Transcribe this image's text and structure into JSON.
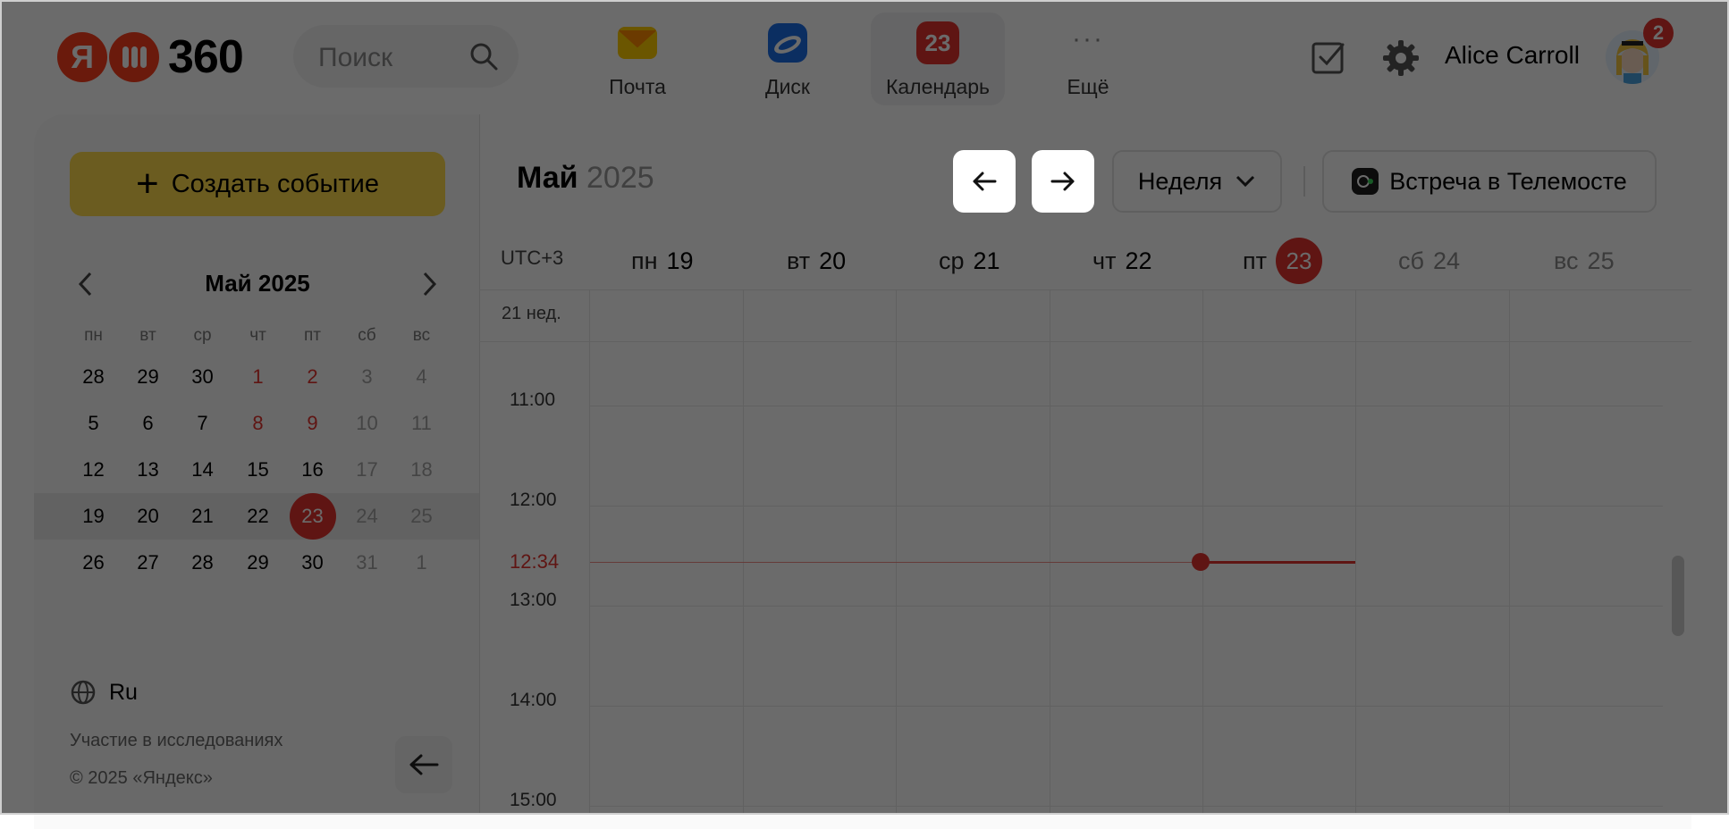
{
  "header": {
    "logo_text": "360",
    "logo_letter": "Я",
    "search_placeholder": "Поиск",
    "apps": [
      {
        "label": "Почта"
      },
      {
        "label": "Диск"
      },
      {
        "label": "Календарь",
        "icon_text": "23"
      },
      {
        "label": "Ещё",
        "icon_text": "···"
      }
    ],
    "user_name": "Alice Carroll",
    "notification_count": "2"
  },
  "sidebar": {
    "create_label": "Создать событие",
    "mini_calendar": {
      "title": "Май 2025",
      "weekdays": [
        "пн",
        "вт",
        "ср",
        "чт",
        "пт",
        "сб",
        "вс"
      ],
      "weeks": [
        [
          "28",
          "29",
          "30",
          "1",
          "2",
          "3",
          "4"
        ],
        [
          "5",
          "6",
          "7",
          "8",
          "9",
          "10",
          "11"
        ],
        [
          "12",
          "13",
          "14",
          "15",
          "16",
          "17",
          "18"
        ],
        [
          "19",
          "20",
          "21",
          "22",
          "23",
          "24",
          "25"
        ],
        [
          "26",
          "27",
          "28",
          "29",
          "30",
          "31",
          "1"
        ]
      ]
    },
    "language": "Ru",
    "research_link": "Участие в исследованиях",
    "copyright": "© 2025 «Яндекс»"
  },
  "calendar": {
    "month": "Май",
    "year": "2025",
    "view_label": "Неделя",
    "telemost_label": "Встреча в Телемосте",
    "timezone": "UTC+3",
    "week_label": "21 нед.",
    "days": [
      {
        "wd": "пн",
        "num": "19"
      },
      {
        "wd": "вт",
        "num": "20"
      },
      {
        "wd": "ср",
        "num": "21"
      },
      {
        "wd": "чт",
        "num": "22"
      },
      {
        "wd": "пт",
        "num": "23"
      },
      {
        "wd": "сб",
        "num": "24"
      },
      {
        "wd": "вс",
        "num": "25"
      }
    ],
    "times": [
      "11:00",
      "12:00",
      "13:00",
      "14:00",
      "15:00"
    ],
    "now_time": "12:34"
  },
  "colors": {
    "accent_red": "#e3342f",
    "create_yellow": "#ffdb4d",
    "overlay": "rgba(0,0,0,0.58)"
  }
}
